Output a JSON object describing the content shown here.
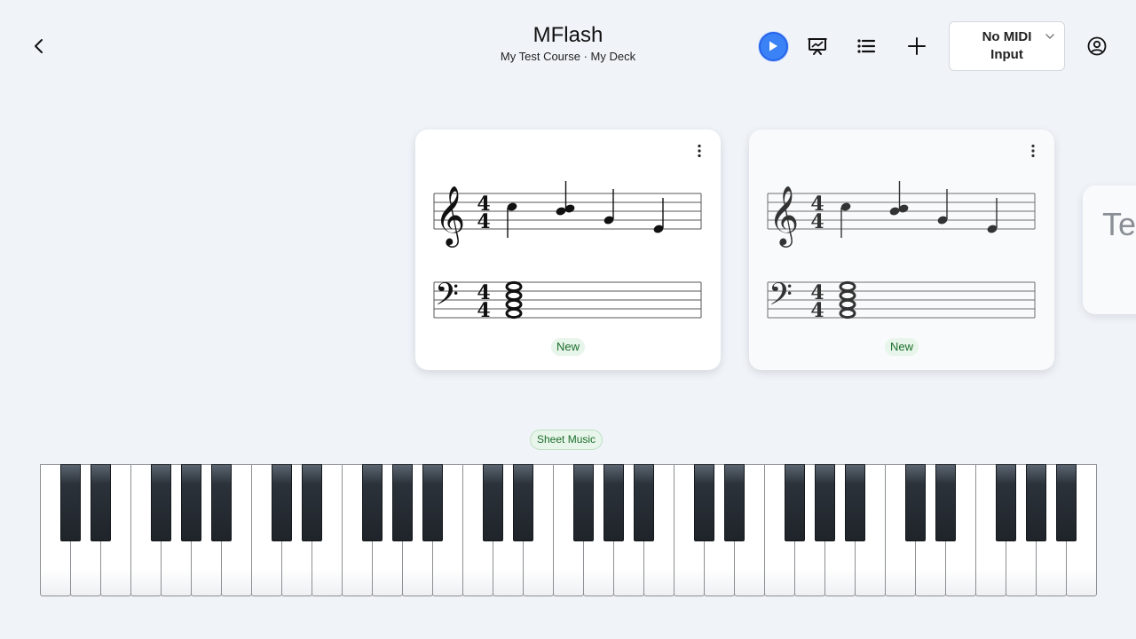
{
  "header": {
    "title": "MFlash",
    "subtitle": "My Test Course · My Deck",
    "back_icon": "chevron-left-icon",
    "tools": [
      "play-icon",
      "presentation-chart-icon",
      "list-icon",
      "plus-icon"
    ],
    "midi_select_value": "No MIDI Input",
    "account_icon": "account-circle-icon",
    "accent_color": "#3b82f6"
  },
  "cards": [
    {
      "status": "New",
      "menu_icon": "more-vertical-icon"
    },
    {
      "status": "New",
      "menu_icon": "more-vertical-icon"
    },
    {
      "peek_text": "Te"
    }
  ],
  "mode": {
    "label": "Sheet Music"
  },
  "piano": {
    "white_keys": 35,
    "black_pattern": "C D _ F G A _"
  }
}
